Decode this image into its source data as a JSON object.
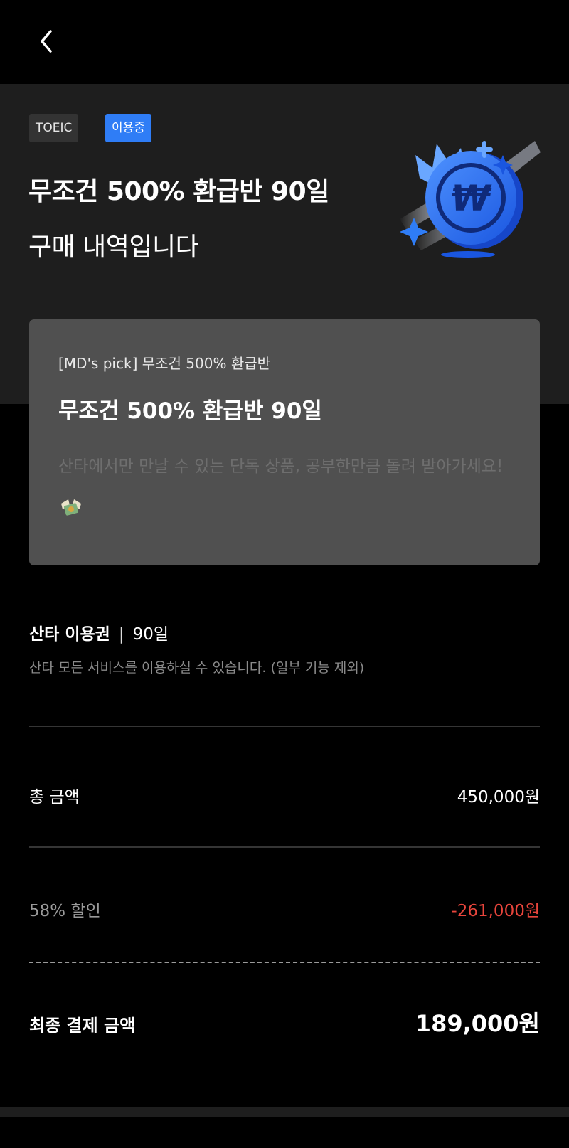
{
  "header": {
    "back_icon": "chevron-left-icon"
  },
  "hero": {
    "exam_tag": "TOEIC",
    "status_badge": "이용중",
    "title": "무조건 500% 환급반 90일",
    "subtitle": "구매 내역입니다",
    "illustration_icon": "won-coin-icon",
    "accent_color": "#2f7df6"
  },
  "product_card": {
    "eyebrow": "[MD's pick] 무조건 500% 환급반",
    "title": "무조건 500% 환급반 90일",
    "description": "산타에서만 만날 수 있는 단독 상품, 공부한만큼 돌려 받아가세요!",
    "description_emoji": "money-with-wings-icon"
  },
  "pass": {
    "name": "산타 이용권",
    "separator": "|",
    "duration": "90일",
    "description": "산타 모든 서비스를 이용하실 수 있습니다. (일부 기능 제외)"
  },
  "summary": {
    "total_label": "총 금액",
    "total_value": "450,000원",
    "discount_label": "58% 할인",
    "discount_value": "-261,000원",
    "discount_color": "#e8453c",
    "final_label": "최종 결제 금액",
    "final_value": "189,000원"
  }
}
